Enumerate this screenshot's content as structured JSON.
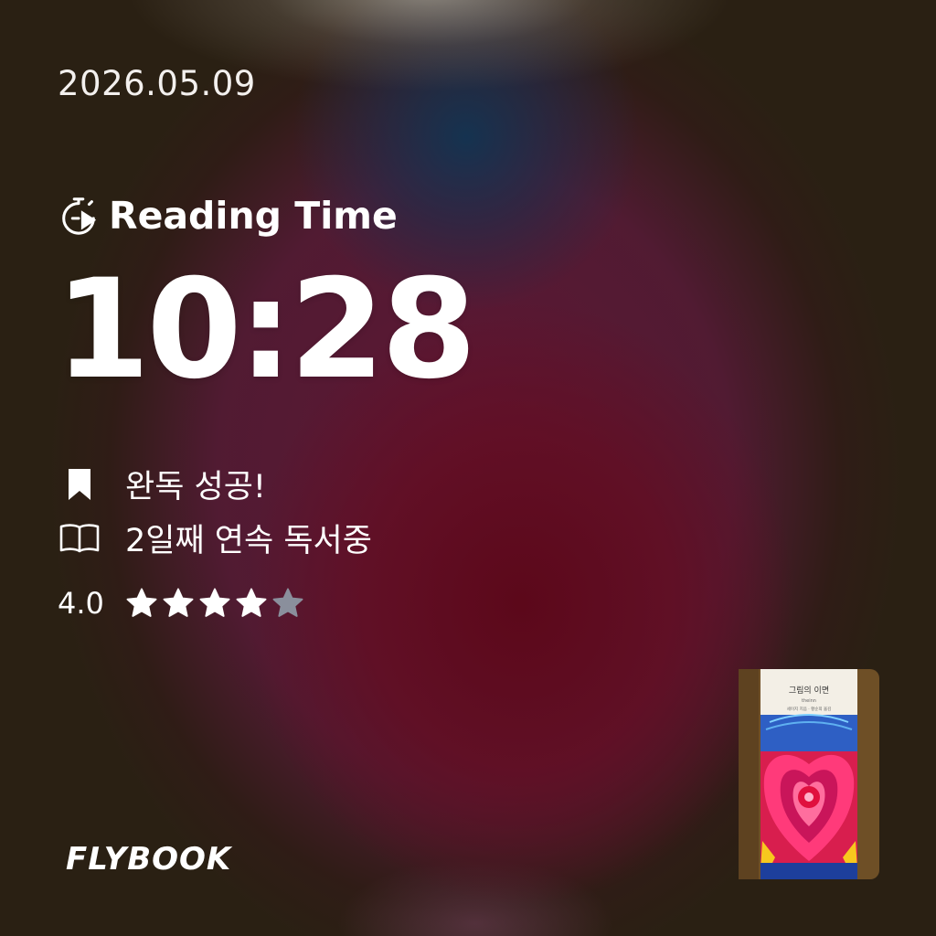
{
  "date": "2026.05.09",
  "reading_label": "Reading Time",
  "reading_time": "10:28",
  "status": {
    "completed": "완독 성공!",
    "streak": "2일째 연속 독서중"
  },
  "rating": {
    "value_label": "4.0",
    "value": 4.0,
    "max": 5,
    "filled_color": "#ffffff",
    "empty_color": "#8a8f9c"
  },
  "brand": "FLYBOOK",
  "book": {
    "cover_title": "그림의 이면",
    "cover_subtitle": "theinn",
    "cover_author": "세이지 지음 · 황순희 옮김"
  },
  "icons": {
    "timer": "stopwatch-play-icon",
    "completed": "bookmark-icon",
    "streak": "open-book-icon",
    "star": "star-icon"
  }
}
